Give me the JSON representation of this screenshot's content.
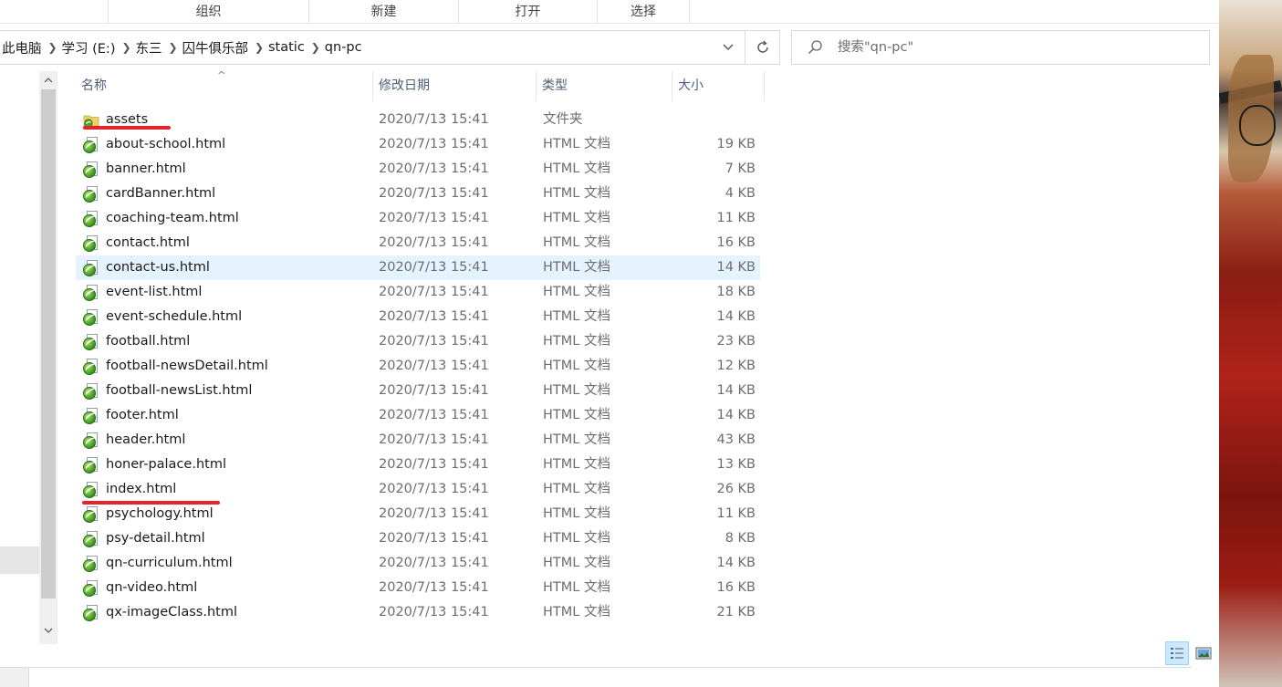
{
  "ribbon": {
    "groups": [
      "组织",
      "新建",
      "打开",
      "选择"
    ]
  },
  "address": {
    "crumbs": [
      "此电脑",
      "学习 (E:)",
      "东三",
      "囚牛俱乐部",
      "static",
      "qn-pc"
    ]
  },
  "search": {
    "placeholder": "搜索\"qn-pc\""
  },
  "columns": {
    "name": "名称",
    "date": "修改日期",
    "type": "类型",
    "size": "大小"
  },
  "files": [
    {
      "name": "assets",
      "date": "2020/7/13 15:41",
      "type": "文件夹",
      "size": "",
      "icon": "folder-icon"
    },
    {
      "name": "about-school.html",
      "date": "2020/7/13 15:41",
      "type": "HTML 文档",
      "size": "19 KB",
      "icon": "html-file-icon"
    },
    {
      "name": "banner.html",
      "date": "2020/7/13 15:41",
      "type": "HTML 文档",
      "size": "7 KB",
      "icon": "html-file-icon"
    },
    {
      "name": "cardBanner.html",
      "date": "2020/7/13 15:41",
      "type": "HTML 文档",
      "size": "4 KB",
      "icon": "html-file-icon"
    },
    {
      "name": "coaching-team.html",
      "date": "2020/7/13 15:41",
      "type": "HTML 文档",
      "size": "11 KB",
      "icon": "html-file-icon"
    },
    {
      "name": "contact.html",
      "date": "2020/7/13 15:41",
      "type": "HTML 文档",
      "size": "16 KB",
      "icon": "html-file-icon"
    },
    {
      "name": "contact-us.html",
      "date": "2020/7/13 15:41",
      "type": "HTML 文档",
      "size": "14 KB",
      "icon": "html-file-icon",
      "hovered": true
    },
    {
      "name": "event-list.html",
      "date": "2020/7/13 15:41",
      "type": "HTML 文档",
      "size": "18 KB",
      "icon": "html-file-icon"
    },
    {
      "name": "event-schedule.html",
      "date": "2020/7/13 15:41",
      "type": "HTML 文档",
      "size": "14 KB",
      "icon": "html-file-icon"
    },
    {
      "name": "football.html",
      "date": "2020/7/13 15:41",
      "type": "HTML 文档",
      "size": "23 KB",
      "icon": "html-file-icon"
    },
    {
      "name": "football-newsDetail.html",
      "date": "2020/7/13 15:41",
      "type": "HTML 文档",
      "size": "12 KB",
      "icon": "html-file-icon"
    },
    {
      "name": "football-newsList.html",
      "date": "2020/7/13 15:41",
      "type": "HTML 文档",
      "size": "14 KB",
      "icon": "html-file-icon"
    },
    {
      "name": "footer.html",
      "date": "2020/7/13 15:41",
      "type": "HTML 文档",
      "size": "14 KB",
      "icon": "html-file-icon"
    },
    {
      "name": "header.html",
      "date": "2020/7/13 15:41",
      "type": "HTML 文档",
      "size": "43 KB",
      "icon": "html-file-icon"
    },
    {
      "name": "honer-palace.html",
      "date": "2020/7/13 15:41",
      "type": "HTML 文档",
      "size": "13 KB",
      "icon": "html-file-icon"
    },
    {
      "name": "index.html",
      "date": "2020/7/13 15:41",
      "type": "HTML 文档",
      "size": "26 KB",
      "icon": "html-file-icon"
    },
    {
      "name": "psychology.html",
      "date": "2020/7/13 15:41",
      "type": "HTML 文档",
      "size": "11 KB",
      "icon": "html-file-icon"
    },
    {
      "name": "psy-detail.html",
      "date": "2020/7/13 15:41",
      "type": "HTML 文档",
      "size": "8 KB",
      "icon": "html-file-icon"
    },
    {
      "name": "qn-curriculum.html",
      "date": "2020/7/13 15:41",
      "type": "HTML 文档",
      "size": "14 KB",
      "icon": "html-file-icon"
    },
    {
      "name": "qn-video.html",
      "date": "2020/7/13 15:41",
      "type": "HTML 文档",
      "size": "16 KB",
      "icon": "html-file-icon"
    },
    {
      "name": "qx-imageClass.html",
      "date": "2020/7/13 15:41",
      "type": "HTML 文档",
      "size": "21 KB",
      "icon": "html-file-icon"
    }
  ],
  "annotations": {
    "underlined_items": [
      "assets",
      "index.html"
    ],
    "stroke_color": "#e8222a"
  },
  "colors": {
    "hover_row": "#e5f3ff",
    "header_text": "#4c607a",
    "active_view": "#cce8ff"
  }
}
